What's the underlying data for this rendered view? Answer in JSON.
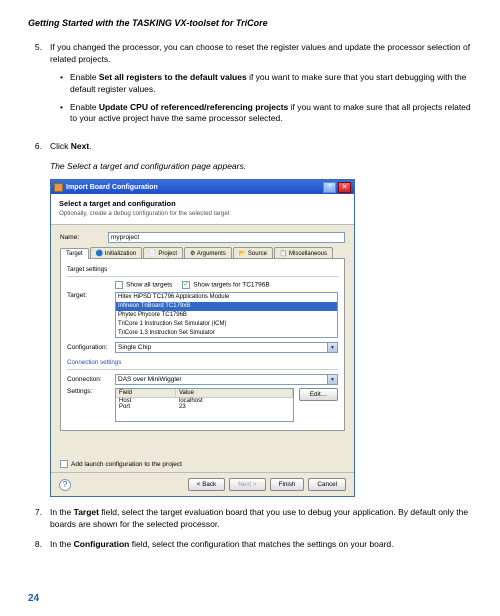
{
  "doc_title": "Getting Started with the TASKING VX-toolset for TriCore",
  "steps": {
    "s5": {
      "num": "5.",
      "text_a": "If you changed the processor, you can choose to reset the register values and update the processor selection of related projects.",
      "b1_prefix": "Enable ",
      "b1_bold": "Set all registers to the default values",
      "b1_suffix": " if you want to make sure that you start debugging with the default register values.",
      "b2_prefix": "Enable ",
      "b2_bold": "Update CPU of referenced/referencing projects",
      "b2_suffix": " if you want to make sure that all projects related to your active project have the same processor selected."
    },
    "s6": {
      "num": "6.",
      "text_a": "Click ",
      "bold": "Next",
      "text_b": ".",
      "italic": "The Select a target and configuration page appears."
    },
    "s7": {
      "num": "7.",
      "text_a": "In the ",
      "bold": "Target",
      "text_b": " field, select the target evaluation board that you use to debug your application. By default only the boards are shown for the selected processor."
    },
    "s8": {
      "num": "8.",
      "text_a": "In the ",
      "bold": "Configuration",
      "text_b": " field, select the configuration that matches the settings on your board."
    }
  },
  "dialog": {
    "title": "Import Board Configuration",
    "banner_title": "Select a target and configuration",
    "banner_sub": "Optionally, create a debug configuration for the selected target",
    "name_label": "Name:",
    "name_value": "myproject",
    "tabs": [
      "Target",
      "Initialization",
      "Project",
      "Arguments",
      "Source",
      "Miscellaneous"
    ],
    "target_group": "Target settings",
    "show_all": "Show all targets",
    "show_tc": "Show targets for TC1796B",
    "target_label": "Target:",
    "target_items": [
      "Hitex HiPSD TC1796 Applications Module",
      "Infineon TriBoard TC179xB",
      "Phytec Phycore TC1796B",
      "TriCore 1 Instruction Set Simulator (ICM)",
      "TriCore 1.3 Instruction Set Simulator"
    ],
    "config_label": "Configuration:",
    "config_value": "Single Chip",
    "conn_group": "Connection settings",
    "conn_label": "Connection:",
    "conn_value": "DAS over MiniWiggler",
    "settings_label": "Settings:",
    "settings_hdr_field": "Field",
    "settings_hdr_value": "Value",
    "settings_rows": [
      {
        "f": "Host",
        "v": "localhost"
      },
      {
        "f": "Port",
        "v": "23"
      }
    ],
    "edit_btn": "Edit…",
    "add_launch": "Add launch configuration to the project",
    "btn_back": "< Back",
    "btn_next": "Next >",
    "btn_finish": "Finish",
    "btn_cancel": "Cancel"
  },
  "page_number": "24"
}
